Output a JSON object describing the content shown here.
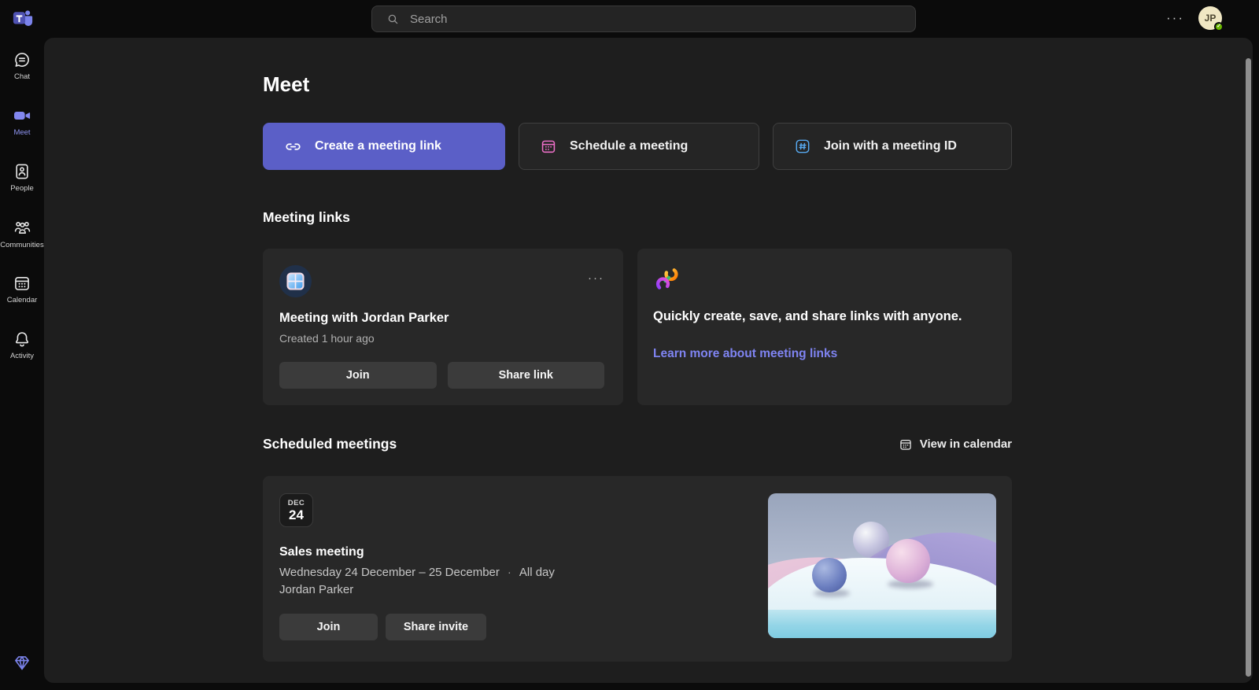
{
  "topbar": {
    "search_placeholder": "Search",
    "more_glyph": "···",
    "avatar_initials": "JP"
  },
  "sidebar": {
    "items": [
      {
        "label": "Chat",
        "icon": "chat-icon"
      },
      {
        "label": "Meet",
        "icon": "video-camera-icon",
        "active": true
      },
      {
        "label": "People",
        "icon": "contact-card-icon"
      },
      {
        "label": "Communities",
        "icon": "people-group-icon"
      },
      {
        "label": "Calendar",
        "icon": "calendar-icon"
      },
      {
        "label": "Activity",
        "icon": "bell-icon"
      }
    ],
    "bottom_icon": "gem-icon"
  },
  "page": {
    "title": "Meet",
    "actions": [
      {
        "label": "Create a meeting link",
        "icon": "link-icon",
        "primary": true
      },
      {
        "label": "Schedule a meeting",
        "icon": "calendar-icon"
      },
      {
        "label": "Join with a meeting ID",
        "icon": "hash-icon"
      }
    ]
  },
  "meeting_links": {
    "heading": "Meeting links",
    "link_card": {
      "more_glyph": "···",
      "title": "Meeting with Jordan Parker",
      "created": "Created 1 hour ago",
      "join_label": "Join",
      "share_label": "Share link"
    },
    "info_card": {
      "text": "Quickly create, save, and share links with anyone.",
      "link_label": "Learn more about meeting links"
    }
  },
  "scheduled": {
    "heading": "Scheduled meetings",
    "view_in_calendar_label": "View in calendar",
    "event": {
      "month": "DEC",
      "day": "24",
      "title": "Sales meeting",
      "date_range": "Wednesday 24 December – 25 December",
      "separator": "·",
      "all_day": "All day",
      "organizer": "Jordan Parker",
      "join_label": "Join",
      "share_label": "Share invite"
    }
  },
  "colors": {
    "accent": "#5b5fc7",
    "link_text": "#7f84f2",
    "presence_available": "#6bb700",
    "avatar_bg": "#f0e7c3",
    "panel_bg": "#1e1e1e",
    "card_bg": "#282828"
  }
}
